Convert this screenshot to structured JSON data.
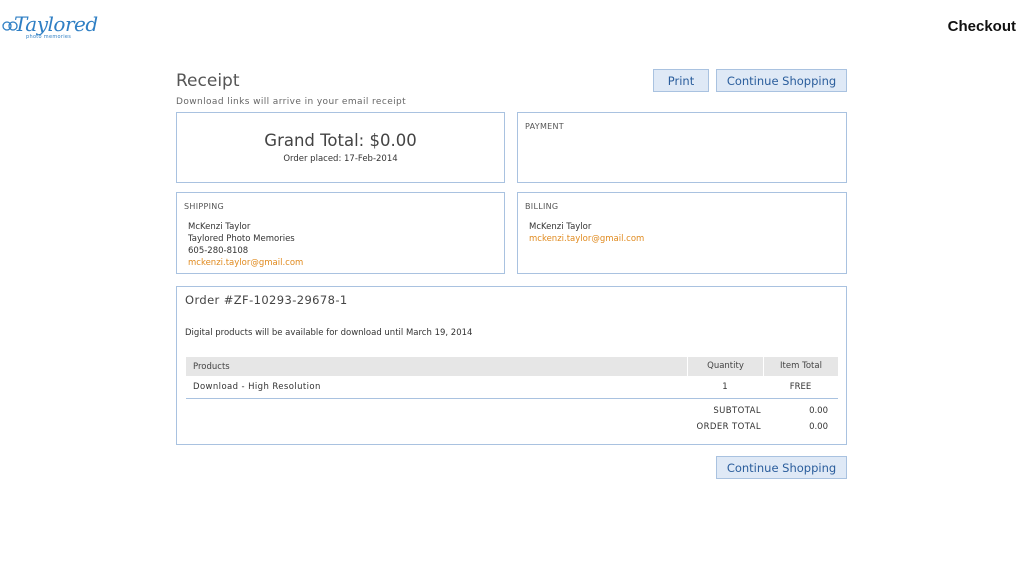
{
  "header": {
    "logo_text": "Taylored",
    "logo_sub": "photo memories",
    "checkout_label": "Checkout"
  },
  "receipt": {
    "title": "Receipt",
    "subtitle": "Download links will arrive in your email receipt",
    "print_label": "Print",
    "continue_label": "Continue Shopping"
  },
  "summary": {
    "grand_total": "Grand Total: $0.00",
    "order_placed": "Order placed: 17-Feb-2014",
    "payment_heading": "PAYMENT"
  },
  "shipping": {
    "heading": "SHIPPING",
    "name": "McKenzi Taylor",
    "company": "Taylored Photo Memories",
    "phone": "605-280-8108",
    "email": "mckenzi.taylor@gmail.com"
  },
  "billing": {
    "heading": "BILLING",
    "name": "McKenzi Taylor",
    "email": "mckenzi.taylor@gmail.com"
  },
  "order": {
    "number": "Order #ZF-10293-29678-1",
    "digital_note": "Digital products will be available for download until March 19, 2014",
    "columns": [
      "Products",
      "Quantity",
      "Item Total"
    ],
    "rows": [
      {
        "product": "Download - High Resolution",
        "quantity": "1",
        "total": "FREE"
      }
    ],
    "subtotal_label": "SUBTOTAL",
    "subtotal_value": "0.00",
    "order_total_label": "ORDER TOTAL",
    "order_total_value": "0.00"
  },
  "colors": {
    "accent": "#2a5d9c",
    "button_bg": "#dfe9f6",
    "border": "#a9c2e0",
    "email": "#e08a1e"
  }
}
